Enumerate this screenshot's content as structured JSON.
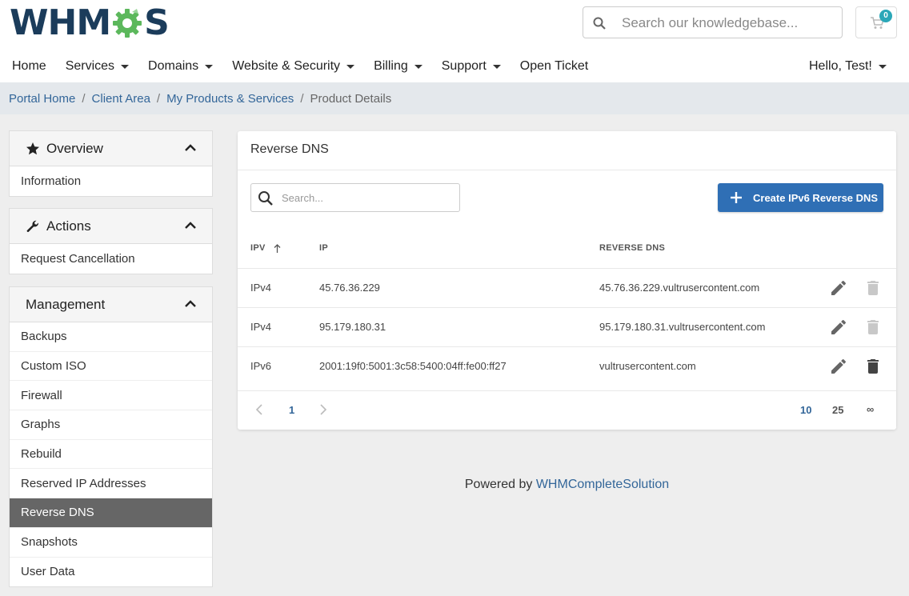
{
  "brand": {
    "logo_prefix": "WHM",
    "logo_suffix": "S",
    "colors": {
      "navy": "#1b3c5b",
      "gear": "#5cb85c",
      "primary": "#2f6fb5",
      "active": "#666666",
      "badge": "#2ba7b8"
    }
  },
  "header": {
    "search_placeholder": "Search our knowledgebase...",
    "cart_count": "0"
  },
  "nav": {
    "items": [
      {
        "label": "Home",
        "dropdown": false
      },
      {
        "label": "Services",
        "dropdown": true
      },
      {
        "label": "Domains",
        "dropdown": true
      },
      {
        "label": "Website & Security",
        "dropdown": true
      },
      {
        "label": "Billing",
        "dropdown": true
      },
      {
        "label": "Support",
        "dropdown": true
      },
      {
        "label": "Open Ticket",
        "dropdown": false
      }
    ],
    "user_greeting": "Hello, Test!"
  },
  "breadcrumb": {
    "links": [
      "Portal Home",
      "Client Area",
      "My Products & Services"
    ],
    "current": "Product Details"
  },
  "sidebar": {
    "overview": {
      "title": "Overview",
      "icon": "star-icon",
      "items": [
        "Information"
      ]
    },
    "actions": {
      "title": "Actions",
      "icon": "wrench-icon",
      "items": [
        "Request Cancellation"
      ]
    },
    "management": {
      "title": "Management",
      "items": [
        "Backups",
        "Custom ISO",
        "Firewall",
        "Graphs",
        "Rebuild",
        "Reserved IP Addresses",
        "Reverse DNS",
        "Snapshots",
        "User Data"
      ],
      "active": "Reverse DNS"
    }
  },
  "main": {
    "title": "Reverse DNS",
    "search_placeholder": "Search...",
    "create_button": "Create IPv6 Reverse DNS",
    "columns": {
      "ipv": "IPV",
      "ip": "IP",
      "reverse_dns": "REVERSE DNS"
    },
    "rows": [
      {
        "ipv": "IPv4",
        "ip": "45.76.36.229",
        "reverse_dns": "45.76.36.229.vultrusercontent.com",
        "delete_enabled": false
      },
      {
        "ipv": "IPv4",
        "ip": "95.179.180.31",
        "reverse_dns": "95.179.180.31.vultrusercontent.com",
        "delete_enabled": false
      },
      {
        "ipv": "IPv6",
        "ip": "2001:19f0:5001:3c58:5400:04ff:fe00:ff27",
        "reverse_dns": "vultrusercontent.com",
        "delete_enabled": true
      }
    ],
    "pagination": {
      "current_page": "1",
      "page_sizes": [
        "10",
        "25",
        "∞"
      ],
      "selected_size": "10"
    }
  },
  "footer": {
    "prefix": "Powered by",
    "link": "WHMCompleteSolution"
  }
}
